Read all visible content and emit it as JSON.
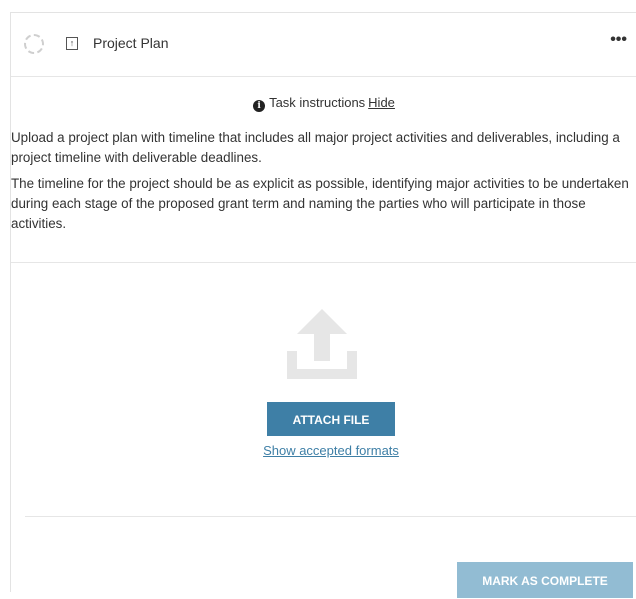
{
  "task": {
    "title": "Project Plan",
    "type_icon": "upload-arrow-icon",
    "more_label": "•••"
  },
  "instructions": {
    "heading": "Task instructions",
    "hide_label": "Hide",
    "paragraphs": [
      "Upload a project plan with timeline that includes all major project activities and deliverables, including a project timeline with deliverable deadlines.",
      "The timeline for the project should be as explicit as possible, identifying major activities to be undertaken during each stage of the proposed grant term and naming the parties who will participate in those activities."
    ]
  },
  "upload": {
    "attach_label": "ATTACH FILE",
    "formats_label": "Show accepted formats"
  },
  "footer": {
    "complete_label": "MARK AS COMPLETE"
  },
  "colors": {
    "primary": "#3e7fa6",
    "primary_disabled": "#92bcd3",
    "upload_icon": "#e6e6e6"
  }
}
